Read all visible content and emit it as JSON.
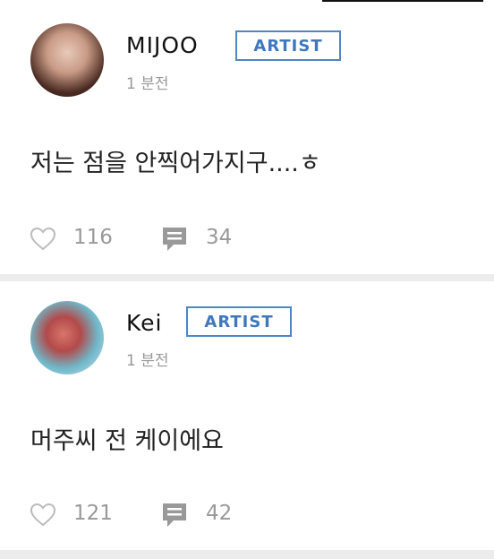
{
  "posts": [
    {
      "author": "MIJOO",
      "badge": "ARTIST",
      "time": "1 분전",
      "text": "저는 점을 안찍어가지구....ㅎ",
      "likes": "116",
      "comments": "34"
    },
    {
      "author": "Kei",
      "badge": "ARTIST",
      "time": "1 분전",
      "text": "머주씨 전 케이에요",
      "likes": "121",
      "comments": "42"
    }
  ],
  "icons": {
    "like": "heart-outline-icon",
    "comment": "speech-bubble-icon"
  },
  "colors": {
    "badge": "#4f86c6",
    "muted": "#999999",
    "divider": "#ececec"
  }
}
